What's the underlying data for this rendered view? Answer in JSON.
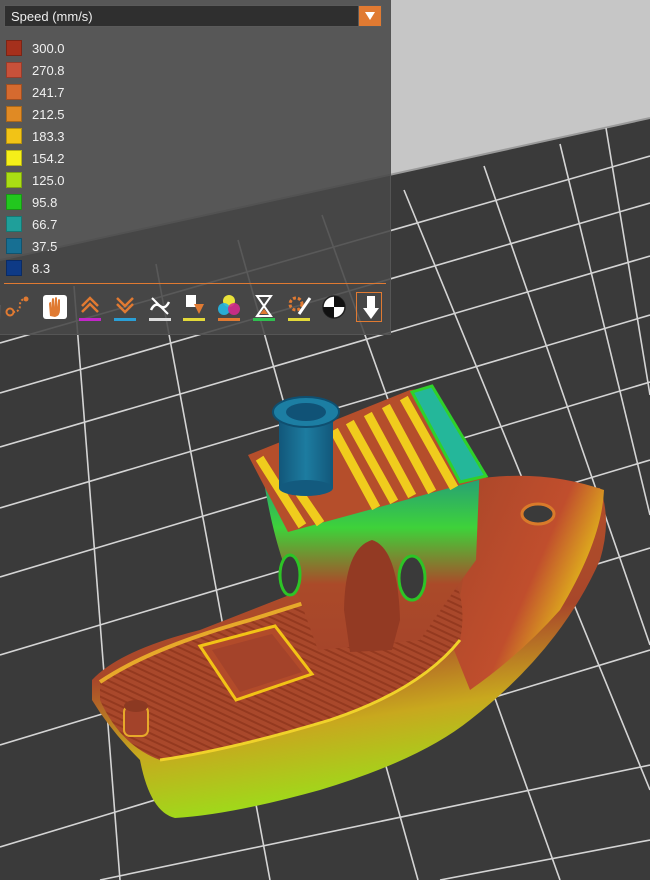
{
  "view_selector": {
    "selected_label": "Speed (mm/s)"
  },
  "legend": {
    "items": [
      {
        "value": "300.0",
        "color": "#a5301c"
      },
      {
        "value": "270.8",
        "color": "#c8513a"
      },
      {
        "value": "241.7",
        "color": "#d56a2f"
      },
      {
        "value": "212.5",
        "color": "#e08a24"
      },
      {
        "value": "183.3",
        "color": "#f2c316"
      },
      {
        "value": "154.2",
        "color": "#f5ef19"
      },
      {
        "value": "125.0",
        "color": "#aadd14"
      },
      {
        "value": "95.8",
        "color": "#22c71e"
      },
      {
        "value": "66.7",
        "color": "#1f9f9a"
      },
      {
        "value": "37.5",
        "color": "#176f93"
      },
      {
        "value": "8.3",
        "color": "#0e3a86"
      }
    ]
  },
  "toolbar": {
    "icons": [
      "travel-icon",
      "wipe-hand-icon",
      "retraction-icon",
      "deretraction-icon",
      "seams-icon",
      "tool-change-icon",
      "color-change-icon",
      "pause-icon",
      "custom-gcode-icon",
      "center-of-gravity-icon",
      "tool-marker-icon"
    ]
  },
  "colors": {
    "accent": "#e07a32",
    "bed_background": "#3a3a3a",
    "bed_grid": "#d9d9d9"
  }
}
